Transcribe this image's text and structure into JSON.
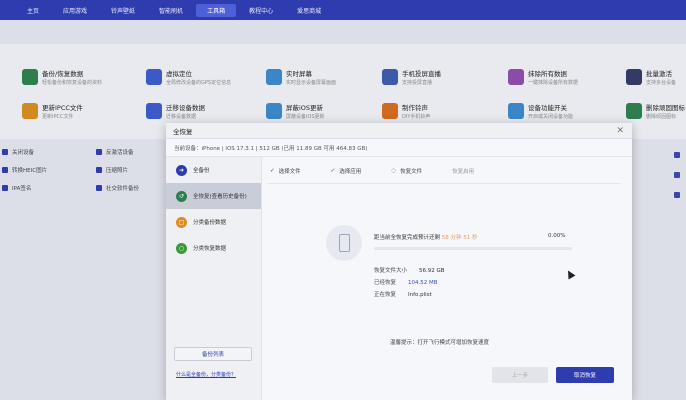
{
  "nav": [
    "主页",
    "应用游戏",
    "铃声壁纸",
    "智能刷机",
    "工具箱",
    "教程中心",
    "爱思商城"
  ],
  "nav_active": 4,
  "tools": [
    {
      "title": "备份/恢复数据",
      "desc": "轻松备份和恢复设备的资料",
      "color": "#2e7d4f"
    },
    {
      "title": "虚拟定位",
      "desc": "全局修改设备的GPS定位信息",
      "color": "#3a5bc7"
    },
    {
      "title": "实时屏幕",
      "desc": "实时显示设备屏幕画面",
      "color": "#3a86c7"
    },
    {
      "title": "手机投屏直播",
      "desc": "支持投屏直播",
      "color": "#3d5aa8"
    },
    {
      "title": "抹除所有数据",
      "desc": "一键抹除设备所有数据",
      "color": "#8a4ca8"
    },
    {
      "title": "批量激活",
      "desc": "支持多台设备",
      "color": "#333a66"
    },
    {
      "title": "更新IPCC文件",
      "desc": "更新IPCC文件",
      "color": "#d08a20"
    },
    {
      "title": "迁移设备数据",
      "desc": "迁移设备数据",
      "color": "#3a5bc7"
    },
    {
      "title": "屏蔽iOS更新",
      "desc": "屏蔽设备iOS更新",
      "color": "#3a86c7"
    },
    {
      "title": "制作铃声",
      "desc": "DIY手机铃声",
      "color": "#d06a20"
    },
    {
      "title": "设备功能开关",
      "desc": "开启或关闭设备功能",
      "color": "#3a86c7"
    },
    {
      "title": "删除顽固图标",
      "desc": "删除顽固图标",
      "color": "#2e7d4f"
    }
  ],
  "left_features": [
    {
      "label": "关闭设备"
    },
    {
      "label": "反激活设备"
    },
    {
      "label": "转换HEIC图片"
    },
    {
      "label": "压缩照片"
    },
    {
      "label": "IPA签名"
    },
    {
      "label": "社交软件备份"
    }
  ],
  "dialog": {
    "title": "全恢复",
    "close": "✕",
    "device_info": "当前设备：iPhone  |  iOS 17.3.1  |  512 GB (已用 11.89 GB 可用 464.83 GB)",
    "sidebar": [
      {
        "label": "全备份",
        "color": "#2e3cb0",
        "glyph": "➜"
      },
      {
        "label": "全恢复(查看历史备份)",
        "color": "#2e7d4f",
        "glyph": "↺"
      },
      {
        "label": "分类备份数据",
        "color": "#e08a20",
        "glyph": "□"
      },
      {
        "label": "分类恢复数据",
        "color": "#3a9a3a",
        "glyph": "○"
      }
    ],
    "sidebar_active": 1,
    "backup_list_btn": "备份列表",
    "help_link": "什么是全备份，分类备份？",
    "steps": [
      {
        "label": "选择文件",
        "mark": "✓",
        "state": "done"
      },
      {
        "label": "选择应用",
        "mark": "✓",
        "state": "done"
      },
      {
        "label": "恢复文件",
        "mark": "◌",
        "state": "current"
      },
      {
        "label": "恢复启用",
        "mark": "",
        "state": "pending"
      }
    ],
    "progress": {
      "label": "距当前全恢复完成预计还剩",
      "remaining": "58 分钟 51 秒",
      "percent_text": "0.00%",
      "fraction": 0.0
    },
    "stats": [
      {
        "label": "恢复文件大小",
        "value": "56.92 GB",
        "blue": false
      },
      {
        "label": "已经恢复",
        "value": "104.52 MB",
        "blue": true
      },
      {
        "label": "正在恢复",
        "value": "Info.plist",
        "blue": false
      }
    ],
    "tip": "温馨提示：打开飞行模式可增加恢复速度",
    "prev_btn": "上一步",
    "cancel_btn": "取消恢复"
  }
}
